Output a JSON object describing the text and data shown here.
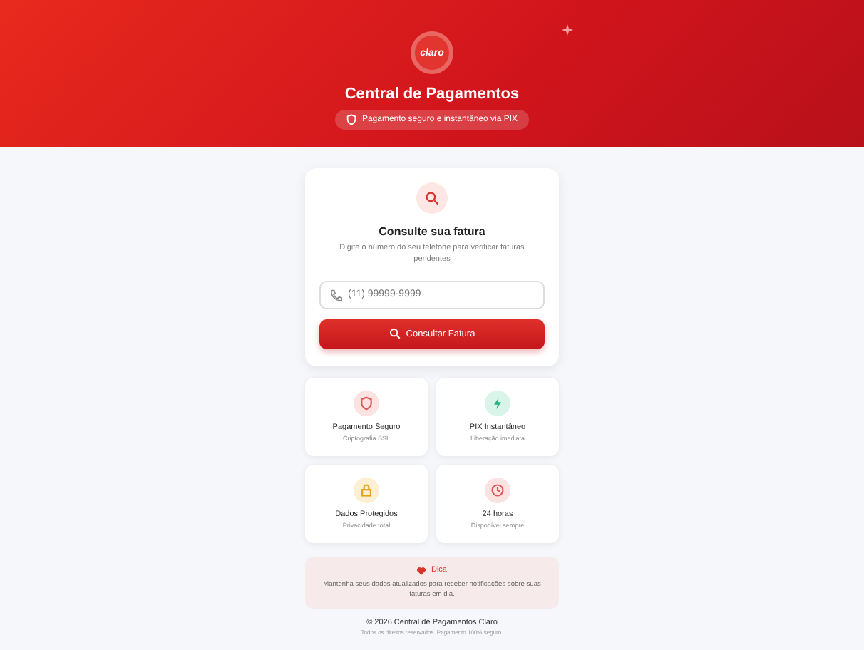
{
  "header": {
    "logo": "claro",
    "title": "Central de Pagamentos",
    "badge": "Pagamento seguro e instantâneo via PIX"
  },
  "lookup": {
    "title": "Consulte sua fatura",
    "description": "Digite o número do seu telefone para verificar faturas pendentes",
    "placeholder": "(11) 99999-9999",
    "button": "Consultar Fatura"
  },
  "features": [
    {
      "kind": "shield",
      "title": "Pagamento Seguro",
      "subtitle": "Criptografia SSL",
      "color": "#fde2e2"
    },
    {
      "kind": "bolt",
      "title": "PIX Instantâneo",
      "subtitle": "Liberação imediata",
      "color": "#d9f5ea"
    },
    {
      "kind": "lock",
      "title": "Dados Protegidos",
      "subtitle": "Privacidade total",
      "color": "#fdf0d2"
    },
    {
      "kind": "clock",
      "title": "24 horas",
      "subtitle": "Disponível sempre",
      "color": "#fde2e2"
    }
  ],
  "tip": {
    "title": "Dica",
    "text": "Mantenha seus dados atualizados para receber notificações sobre suas faturas em dia."
  },
  "footer": {
    "copyright": "© 2026 Central de Pagamentos Claro",
    "note": "Todos os direitos reservados. Pagamento 100% seguro."
  }
}
